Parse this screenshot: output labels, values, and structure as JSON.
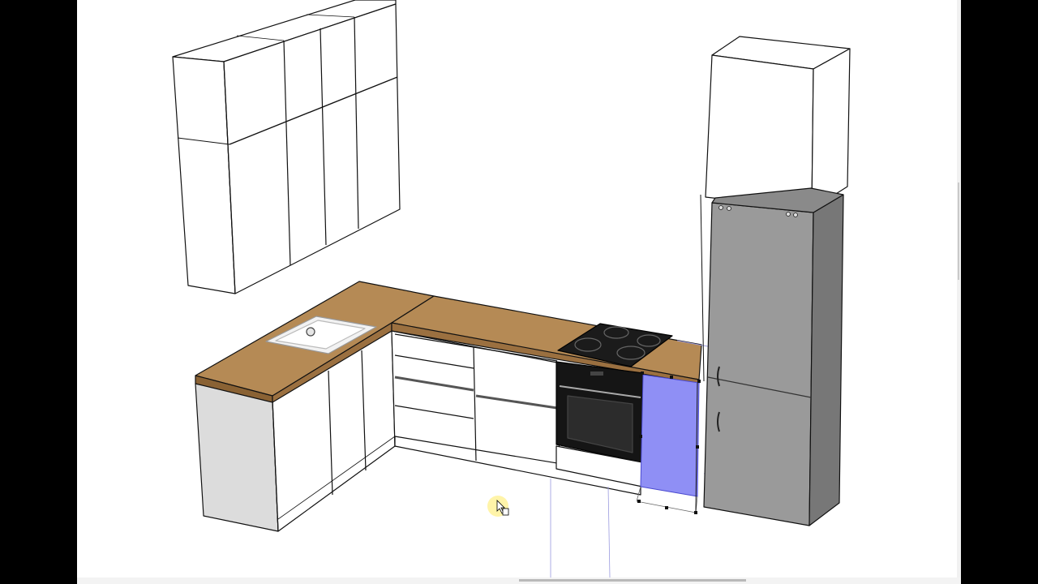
{
  "viewport": {
    "background_color": "#ffffff",
    "frame_color": "#000000"
  },
  "model": {
    "objects": [
      {
        "id": "wall-cabinets",
        "icon": "wall-cabinet-group"
      },
      {
        "id": "base-cabinets",
        "icon": "base-cabinet-group"
      },
      {
        "id": "countertop",
        "icon": "countertop",
        "color": "#a87a44"
      },
      {
        "id": "sink",
        "icon": "sink"
      },
      {
        "id": "cooktop",
        "icon": "induction-hob",
        "color": "#1b1b1b"
      },
      {
        "id": "oven",
        "icon": "built-in-oven",
        "color": "#151515"
      },
      {
        "id": "refrigerator",
        "icon": "fridge-freezer",
        "color": "#8e8e8e"
      },
      {
        "id": "tall-top-cabinet",
        "icon": "tall-cabinet"
      }
    ],
    "selection": {
      "object": "base-cabinet",
      "highlight_color": "#8f8ff5"
    }
  },
  "cursor": {
    "icon": "move-cursor-icon",
    "highlight_color": "#fff29a"
  }
}
